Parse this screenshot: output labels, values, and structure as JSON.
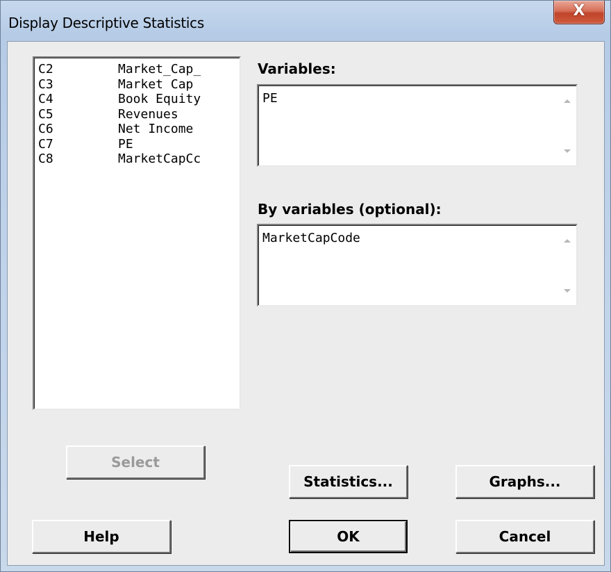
{
  "window": {
    "title": "Display Descriptive Statistics",
    "close_glyph": "X"
  },
  "columns_list": {
    "items": [
      {
        "id": "C2",
        "name": "Market_Cap_"
      },
      {
        "id": "C3",
        "name": "Market Cap"
      },
      {
        "id": "C4",
        "name": "Book Equity"
      },
      {
        "id": "C5",
        "name": "Revenues"
      },
      {
        "id": "C6",
        "name": "Net Income"
      },
      {
        "id": "C7",
        "name": "PE"
      },
      {
        "id": "C8",
        "name": "MarketCapCc"
      }
    ]
  },
  "variables": {
    "label": "Variables:",
    "value": "PE"
  },
  "by_variables": {
    "label": "By variables (optional):",
    "value": "MarketCapCode"
  },
  "buttons": {
    "select": "Select",
    "statistics": "Statistics...",
    "graphs": "Graphs...",
    "help": "Help",
    "ok": "OK",
    "cancel": "Cancel"
  },
  "icons": {
    "close": "close-icon",
    "scroll_up": "scroll-up-arrow-icon",
    "scroll_down": "scroll-down-arrow-icon"
  }
}
